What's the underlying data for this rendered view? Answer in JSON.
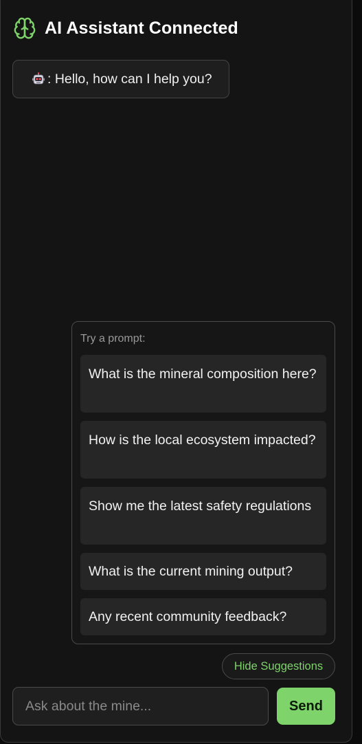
{
  "header": {
    "title": "AI Assistant Connected",
    "icon": "brain-icon"
  },
  "chat": {
    "messages": [
      {
        "sender": "bot",
        "avatar": "robot-icon",
        "text": ": Hello, how can I help you?"
      }
    ]
  },
  "suggestions": {
    "heading": "Try a prompt:",
    "items": [
      "What is the mineral composition here?",
      "How is the local ecosystem impacted?",
      "Show me the latest safety regulations",
      "What is the current mining output?",
      "Any recent community feedback?"
    ],
    "toggle_label": "Hide Suggestions"
  },
  "composer": {
    "placeholder": "Ask about the mine...",
    "value": "",
    "send_label": "Send"
  },
  "colors": {
    "accent": "#7fd36b",
    "background": "#141414",
    "card": "#262626"
  }
}
